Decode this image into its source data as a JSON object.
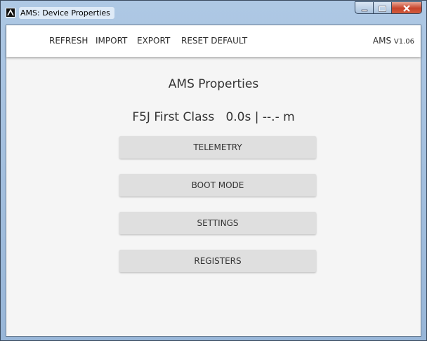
{
  "window": {
    "title": "AMS: Device Properties"
  },
  "toolbar": {
    "items": [
      "REFRESH",
      "IMPORT",
      "EXPORT",
      "RESET DEFAULT"
    ],
    "version_name": "AMS",
    "version_number": "V1.06"
  },
  "main": {
    "title": "AMS Properties",
    "class_name": "F5J First Class",
    "time_value": "0.0s",
    "separator": "|",
    "altitude_value": "--.- m",
    "buttons": [
      "TELEMETRY",
      "BOOT MODE",
      "SETTINGS",
      "REGISTERS"
    ]
  },
  "icons": {
    "app": "ams-logo-icon",
    "minimize": "minimize-icon",
    "maximize": "maximize-icon",
    "close": "close-icon"
  },
  "colors": {
    "content_background": "#f5f5f5",
    "button_background": "#dfdfdf",
    "close_button": "#c7432b"
  }
}
